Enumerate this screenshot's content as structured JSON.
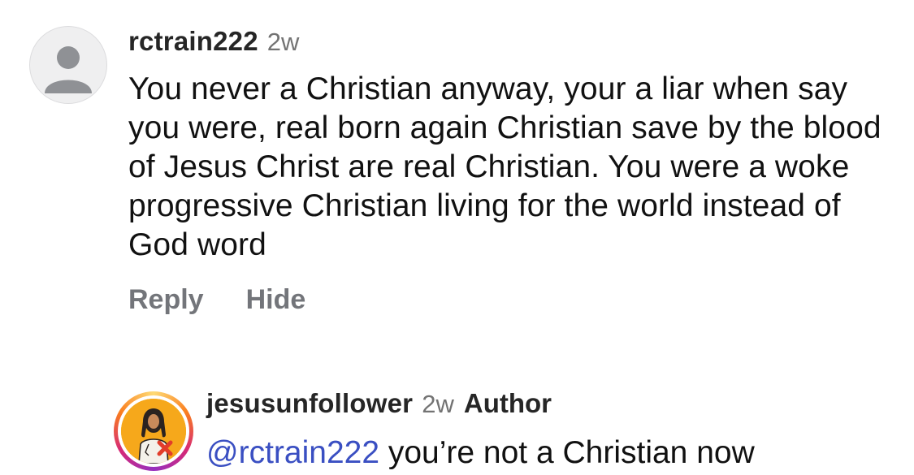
{
  "comments": [
    {
      "username": "rctrain222",
      "time": "2w",
      "text": "You never a Christian anyway, your a liar when say you were, real born again Christian save by the blood of Jesus Christ are real Christian. You were a woke progressive Christian living for the world instead of God word",
      "actions": {
        "reply": "Reply",
        "hide": "Hide"
      },
      "avatar_icon": "default-profile-icon"
    }
  ],
  "reply": {
    "username": "jesusunfollower",
    "time": "2w",
    "badge": "Author",
    "mention": "@rctrain222",
    "text": " you’re not a Christian now",
    "avatar_icon": "jesus-unfollow-avatar",
    "has_story_ring": true
  },
  "colors": {
    "mention": "#3a4fc2",
    "muted": "#737373",
    "action": "#73757a",
    "avatar_bg": "#f6a81b",
    "x_mark": "#e23d2a"
  }
}
